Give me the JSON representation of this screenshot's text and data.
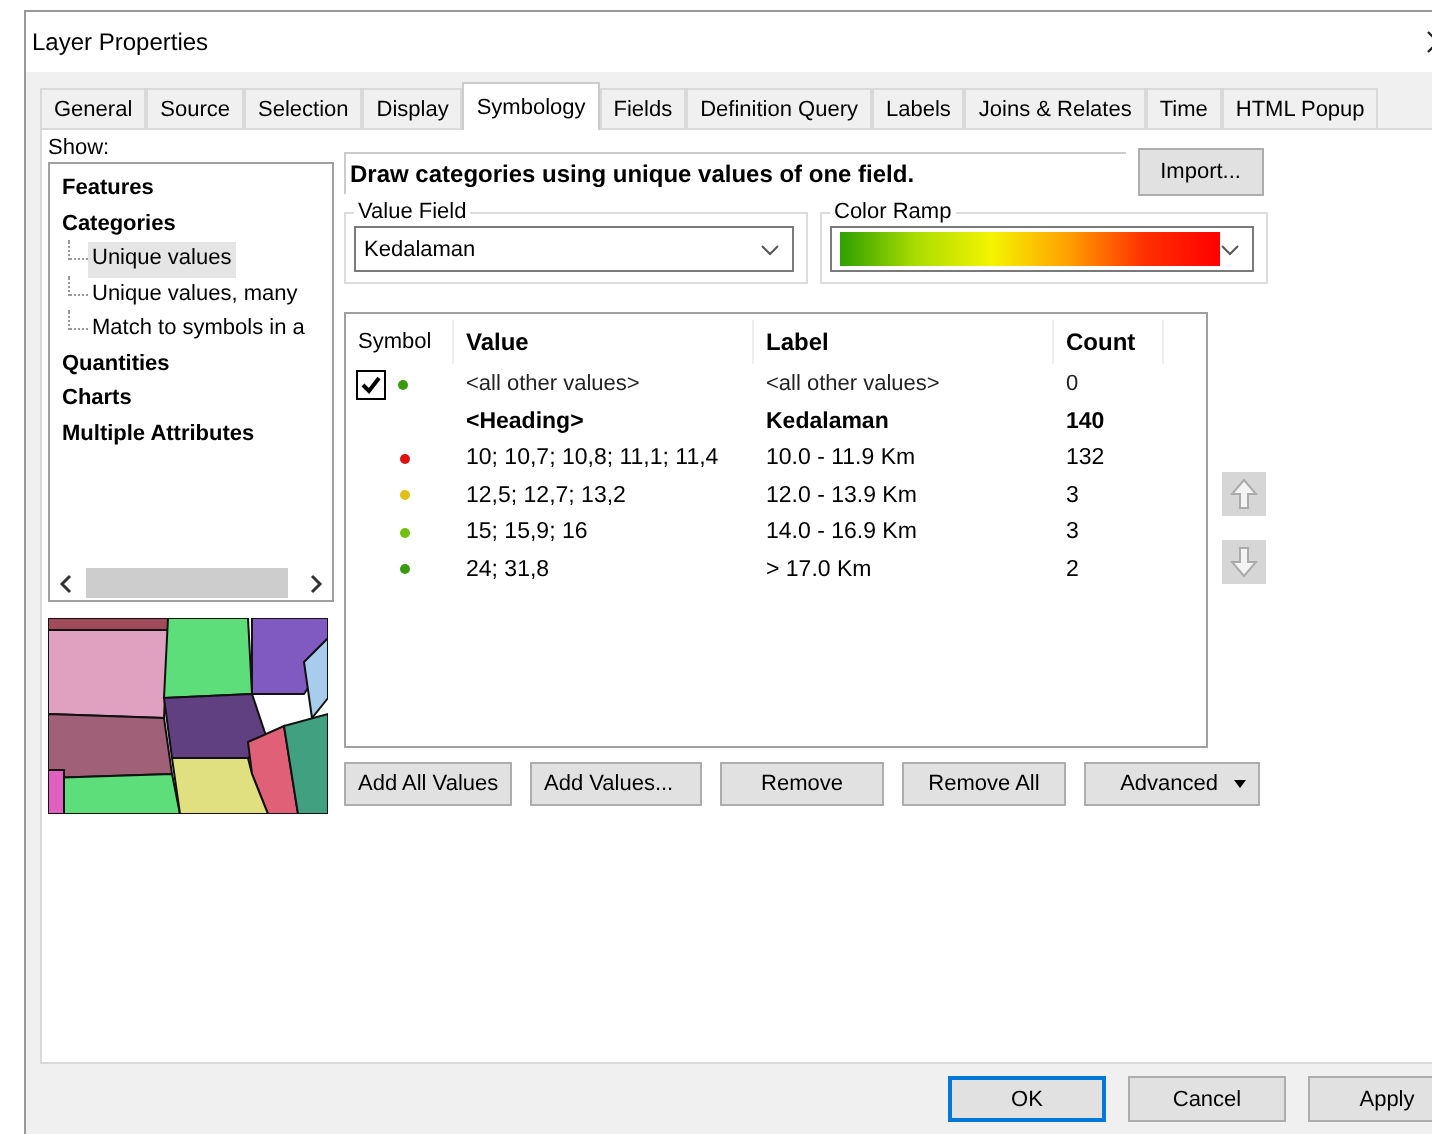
{
  "window": {
    "title": "Layer Properties"
  },
  "tabs": [
    {
      "label": "General",
      "selected": false
    },
    {
      "label": "Source",
      "selected": false
    },
    {
      "label": "Selection",
      "selected": false
    },
    {
      "label": "Display",
      "selected": false
    },
    {
      "label": "Symbology",
      "selected": true
    },
    {
      "label": "Fields",
      "selected": false
    },
    {
      "label": "Definition Query",
      "selected": false
    },
    {
      "label": "Labels",
      "selected": false
    },
    {
      "label": "Joins & Relates",
      "selected": false
    },
    {
      "label": "Time",
      "selected": false
    },
    {
      "label": "HTML Popup",
      "selected": false
    }
  ],
  "show": {
    "label": "Show:",
    "items": [
      {
        "label": "Features",
        "selected": false
      },
      {
        "label": "Categories",
        "selected": false,
        "children": [
          {
            "label": "Unique values",
            "selected": true
          },
          {
            "label": "Unique values, many",
            "selected": false
          },
          {
            "label": "Match to symbols in a",
            "selected": false
          }
        ]
      },
      {
        "label": "Quantities",
        "selected": false
      },
      {
        "label": "Charts",
        "selected": false
      },
      {
        "label": "Multiple Attributes",
        "selected": false
      }
    ]
  },
  "description": "Draw categories using unique values of one field.",
  "import_button": "Import...",
  "value_field": {
    "label": "Value Field",
    "value": "Kedalaman"
  },
  "color_ramp": {
    "label": "Color Ramp"
  },
  "table": {
    "columns": [
      "Symbol",
      "Value",
      "Label",
      "Count"
    ],
    "rows": [
      {
        "kind": "other",
        "checked": true,
        "color": "#3a9a12",
        "value": "<all other values>",
        "label": "<all other values>",
        "count": "0"
      },
      {
        "kind": "heading",
        "value": "<Heading>",
        "label": "Kedalaman",
        "count": "140"
      },
      {
        "kind": "class",
        "color": "#e01010",
        "value": "10; 10,7; 10,8; 11,1; 11,4",
        "label": "10.0 - 11.9 Km",
        "count": "132"
      },
      {
        "kind": "class",
        "color": "#e0c010",
        "value": "12,5; 12,7; 13,2",
        "label": "12.0 - 13.9 Km",
        "count": "3"
      },
      {
        "kind": "class",
        "color": "#70c010",
        "value": "15; 15,9; 16",
        "label": "14.0 - 16.9 Km",
        "count": "3"
      },
      {
        "kind": "class",
        "color": "#3a9a12",
        "value": "24; 31,8",
        "label": "> 17.0 Km",
        "count": "2"
      }
    ]
  },
  "table_buttons": [
    "Add All Values",
    "Add Values...",
    "Remove",
    "Remove All",
    "Advanced"
  ],
  "dialog_buttons": [
    "OK",
    "Cancel",
    "Apply"
  ]
}
